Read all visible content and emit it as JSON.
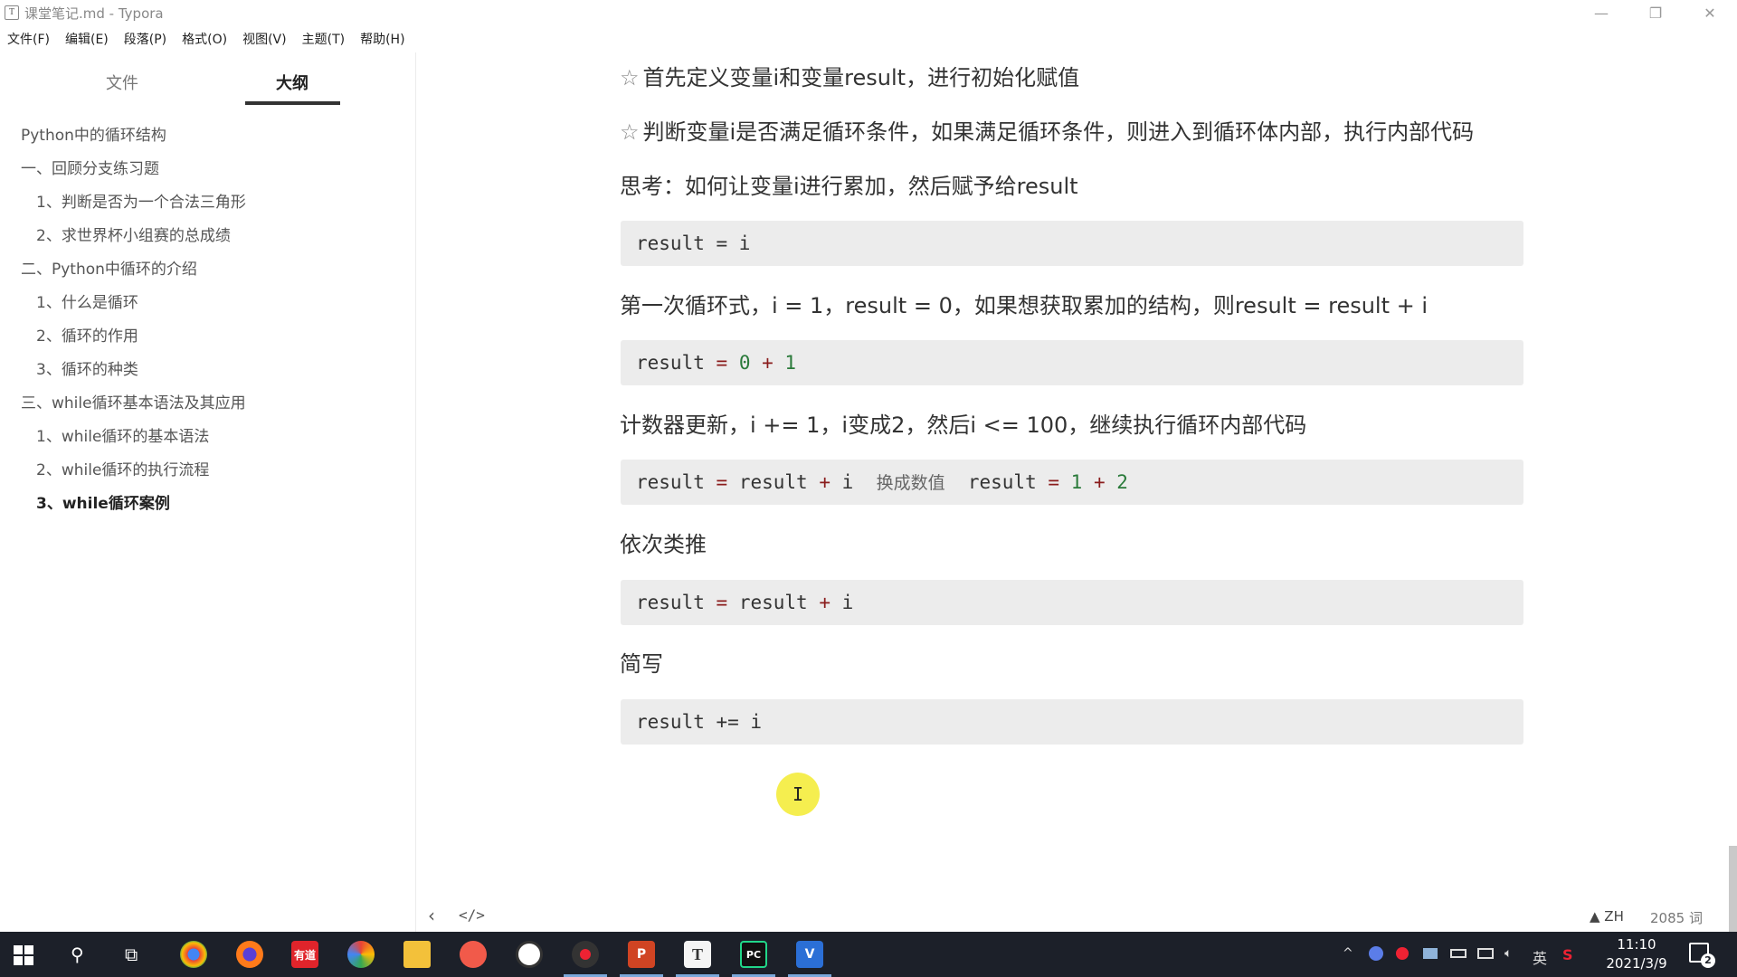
{
  "window": {
    "title": "课堂笔记.md - Typora",
    "app_icon": "T",
    "controls": {
      "minimize": "—",
      "restore": "❐",
      "close": "✕"
    }
  },
  "menu": [
    "文件(F)",
    "编辑(E)",
    "段落(P)",
    "格式(O)",
    "视图(V)",
    "主题(T)",
    "帮助(H)"
  ],
  "sidebar": {
    "tabs": {
      "file": "文件",
      "outline": "大纲"
    },
    "active_tab": "outline",
    "outline": [
      {
        "label": "Python中的循环结构",
        "level": 1
      },
      {
        "label": "一、回顾分支练习题",
        "level": 1
      },
      {
        "label": "1、判断是否为一个合法三角形",
        "level": 2
      },
      {
        "label": "2、求世界杯小组赛的总成绩",
        "level": 2
      },
      {
        "label": "二、Python中循环的介绍",
        "level": 1
      },
      {
        "label": "1、什么是循环",
        "level": 2
      },
      {
        "label": "2、循环的作用",
        "level": 2
      },
      {
        "label": "3、循环的种类",
        "level": 2
      },
      {
        "label": "三、while循环基本语法及其应用",
        "level": 1
      },
      {
        "label": "1、while循环的基本语法",
        "level": 2
      },
      {
        "label": "2、while循环的执行流程",
        "level": 2
      },
      {
        "label": "3、while循环案例",
        "level": 2,
        "active": true
      }
    ]
  },
  "editor": {
    "p1": "首先定义变量i和变量result，进行初始化赋值",
    "p2": "判断变量i是否满足循环条件，如果满足循环条件，则进入到循环体内部，执行内部代码",
    "star": "☆",
    "p3": "思考：如何让变量i进行累加，然后赋予给result",
    "code1": "result = i",
    "p4": "第一次循环式，i = 1，result = 0，如果想获取累加的结构，则result = result + i",
    "code2": {
      "a": "result ",
      "eq": "=",
      "n0": " 0",
      "plus": " +",
      "n1": " 1"
    },
    "p5": "计数器更新，i += 1，i变成2，然后i <= 100，继续执行循环内部代码",
    "code3": {
      "a": "result ",
      "eq": "=",
      "b": " result ",
      "plus": "+",
      "c": " i  ",
      "comment": "换成数值",
      "d": "  result ",
      "eq2": "=",
      "n1": " 1",
      "plus2": " +",
      "n2": " 2"
    },
    "p6": "依次类推",
    "code4": {
      "a": "result ",
      "eq": "=",
      "b": " result ",
      "plus": "+",
      "c": " i"
    },
    "p7": "简写",
    "code5": "result += i",
    "cursor_glyph": "I"
  },
  "footer": {
    "back": "‹",
    "source_mode": "</>",
    "warning": "▲ ZH",
    "word_count": "2085 词"
  },
  "taskbar": {
    "search_glyph": "⚲",
    "taskview_glyph": "⧉",
    "youdao_label": "有道",
    "ppt_label": "P",
    "typora_label": "T",
    "pycharm_label": "PC",
    "vs_label": "V",
    "tray_chevron": "^",
    "tray_lang": "英",
    "tray_s": "S",
    "time": "11:10",
    "date": "2021/3/9",
    "notification_count": "2"
  }
}
